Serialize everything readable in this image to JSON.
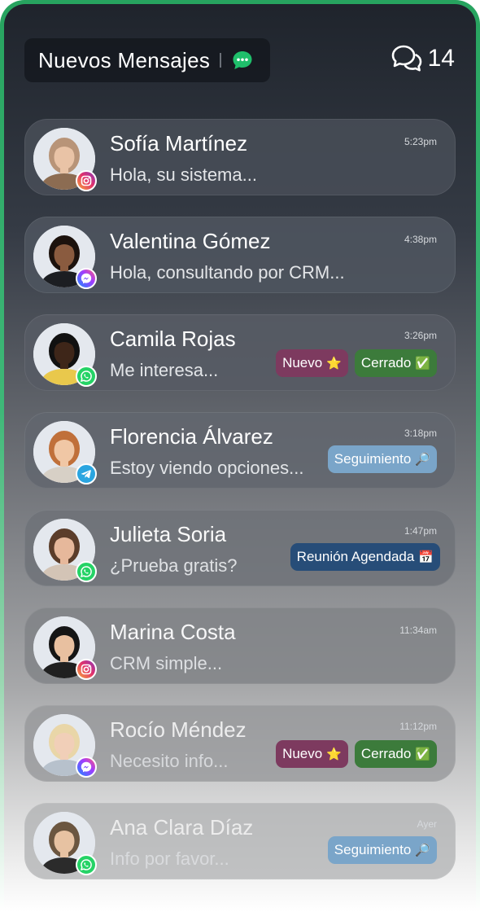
{
  "header": {
    "title": "Nuevos Mensajes",
    "icon": "chat-bubble-icon"
  },
  "counter": {
    "value": "14",
    "icon": "chats-icon"
  },
  "colors": {
    "accent": "#27a35f",
    "instagram": "#e1306c",
    "messenger": "#7b4dff",
    "whatsapp": "#25d366",
    "telegram": "#2aa5e0",
    "tag_nuevo": "#7d3a5f",
    "tag_cerrado": "#3c7b3b",
    "tag_seguimiento": "#7aa5c9",
    "tag_reunion": "#274d78"
  },
  "conversations": [
    {
      "name": "Sofía Martínez",
      "preview": "Hola, su sistema...",
      "time": "5:23pm",
      "channel": "instagram",
      "tags": []
    },
    {
      "name": "Valentina Gómez",
      "preview": "Hola, consultando por CRM...",
      "time": "4:38pm",
      "channel": "messenger",
      "tags": []
    },
    {
      "name": "Camila Rojas",
      "preview": "Me interesa...",
      "time": "3:26pm",
      "channel": "whatsapp",
      "tags": [
        {
          "label": "Nuevo",
          "emoji": "⭐",
          "kind": "nuevo"
        },
        {
          "label": "Cerrado",
          "emoji": "✅",
          "kind": "cerrado"
        }
      ]
    },
    {
      "name": "Florencia Álvarez",
      "preview": "Estoy viendo opciones...",
      "time": "3:18pm",
      "channel": "telegram",
      "tags": [
        {
          "label": "Seguimiento",
          "emoji": "🔎",
          "kind": "seguimiento"
        }
      ]
    },
    {
      "name": "Julieta Soria",
      "preview": "¿Prueba gratis?",
      "time": "1:47pm",
      "channel": "whatsapp",
      "tags": [
        {
          "label": "Reunión Agendada",
          "emoji": "📅",
          "kind": "reunion"
        }
      ]
    },
    {
      "name": "Marina Costa",
      "preview": "CRM simple...",
      "time": "11:34am",
      "channel": "instagram",
      "tags": []
    },
    {
      "name": "Rocío Méndez",
      "preview": "Necesito info...",
      "time": "11:12pm",
      "channel": "messenger",
      "tags": [
        {
          "label": "Nuevo",
          "emoji": "⭐",
          "kind": "nuevo"
        },
        {
          "label": "Cerrado",
          "emoji": "✅",
          "kind": "cerrado"
        }
      ]
    },
    {
      "name": "Ana Clara Díaz",
      "preview": "Info por favor...",
      "time": "Ayer",
      "channel": "whatsapp",
      "tags": [
        {
          "label": "Seguimiento",
          "emoji": "🔎",
          "kind": "seguimiento"
        }
      ]
    }
  ]
}
